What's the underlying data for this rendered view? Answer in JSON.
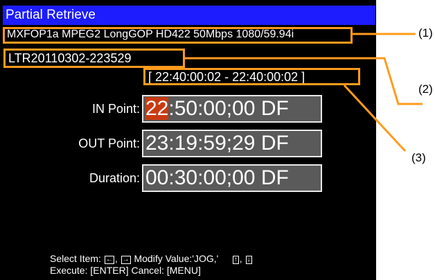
{
  "window": {
    "title": "Partial Retrieve"
  },
  "clip": {
    "format": "MXFOP1a MPEG2 LongGOP HD422 50Mbps 1080/59.94i",
    "name": "LTR20110302-223529",
    "range": "[ 22:40:00:02 - 22:40:00:02 ]"
  },
  "fields": {
    "in_label": "IN Point:",
    "in_hl": "22",
    "in_rest": ":50:00;00 DF",
    "out_label": "OUT Point:",
    "out_value": "23:19:59;29 DF",
    "dur_label": "Duration:",
    "dur_value": "00:30:00;00 DF"
  },
  "help": {
    "select": "Select Item:",
    "comma1": ",",
    "modify": "Modify Value:'JOG,'",
    "comma2": ",",
    "execute": "Execute: [ENTER]  Cancel: [MENU]"
  },
  "callouts": {
    "c1": "(1)",
    "c2": "(2)",
    "c3": "(3)"
  },
  "colors": {
    "screen_bg": "#000000",
    "title_bar": "#1c1cff",
    "highlight_border": "#ff9b1d",
    "selected_digit": "#c83a12",
    "field_bg": "#5a5a5a"
  },
  "icons": {
    "left": "left-arrow-key-icon",
    "right": "right-arrow-key-icon",
    "up": "up-arrow-key-icon",
    "down": "down-arrow-key-icon"
  }
}
